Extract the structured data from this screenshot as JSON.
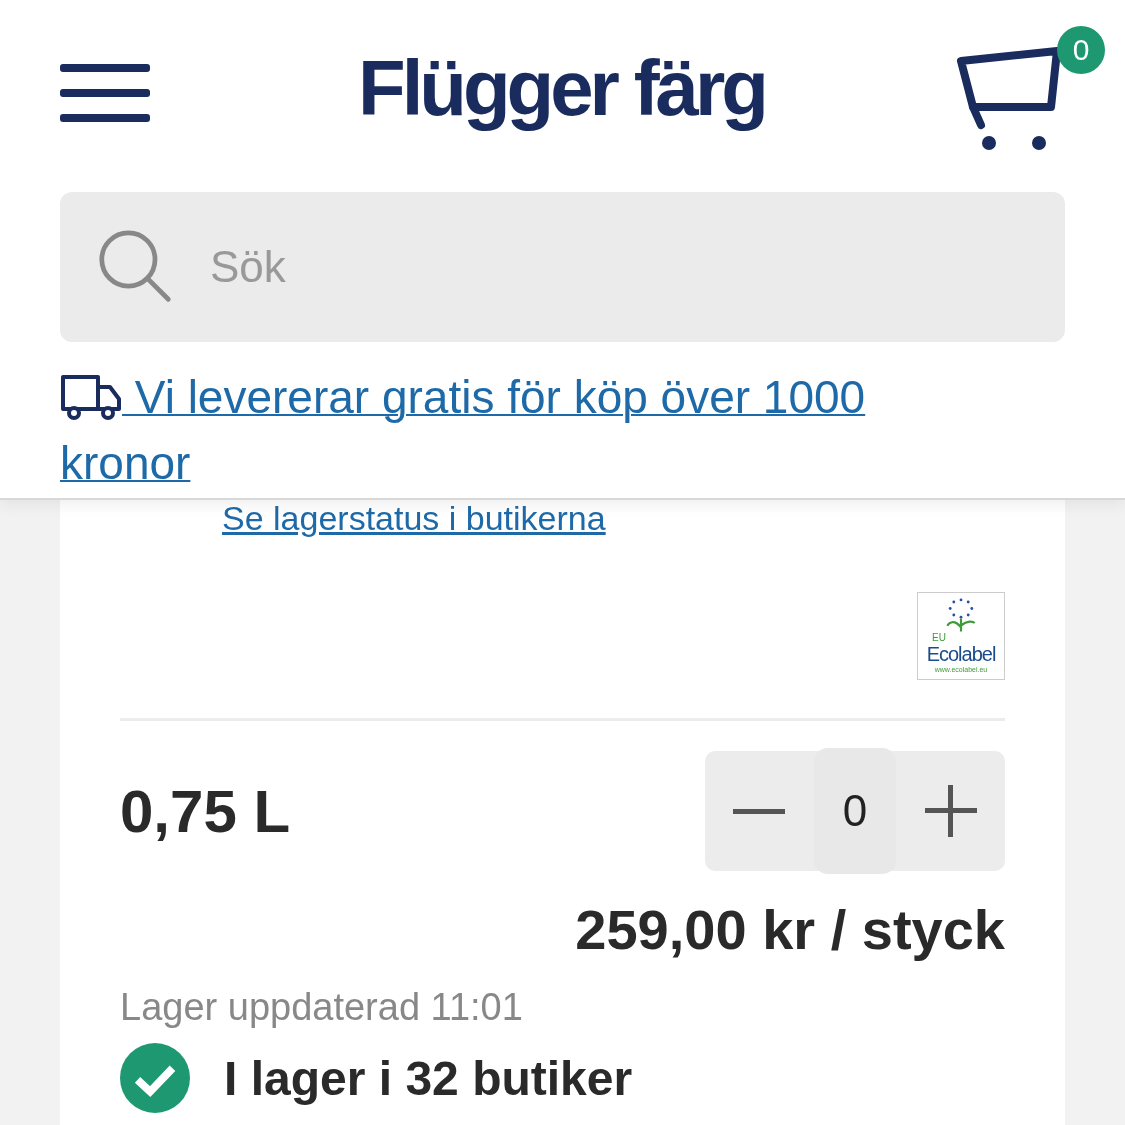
{
  "header": {
    "logo": "Flügger färg",
    "cart_count": "0"
  },
  "search": {
    "placeholder": "Sök"
  },
  "delivery_banner": {
    "text": "Vi levererar gratis för köp över 1000 kronor"
  },
  "product": {
    "stock_link": "Se lagerstatus i butikerna",
    "ecolabel": {
      "region": "EU",
      "name": "Ecolabel",
      "url": "www.ecolabel.eu"
    },
    "size": "0,75 L",
    "quantity": "0",
    "price": "259,00 kr / styck",
    "stock_updated": "Lager uppdaterad 11:01",
    "availability": {
      "in_stock": true,
      "text": "I lager i 32 butiker"
    }
  }
}
